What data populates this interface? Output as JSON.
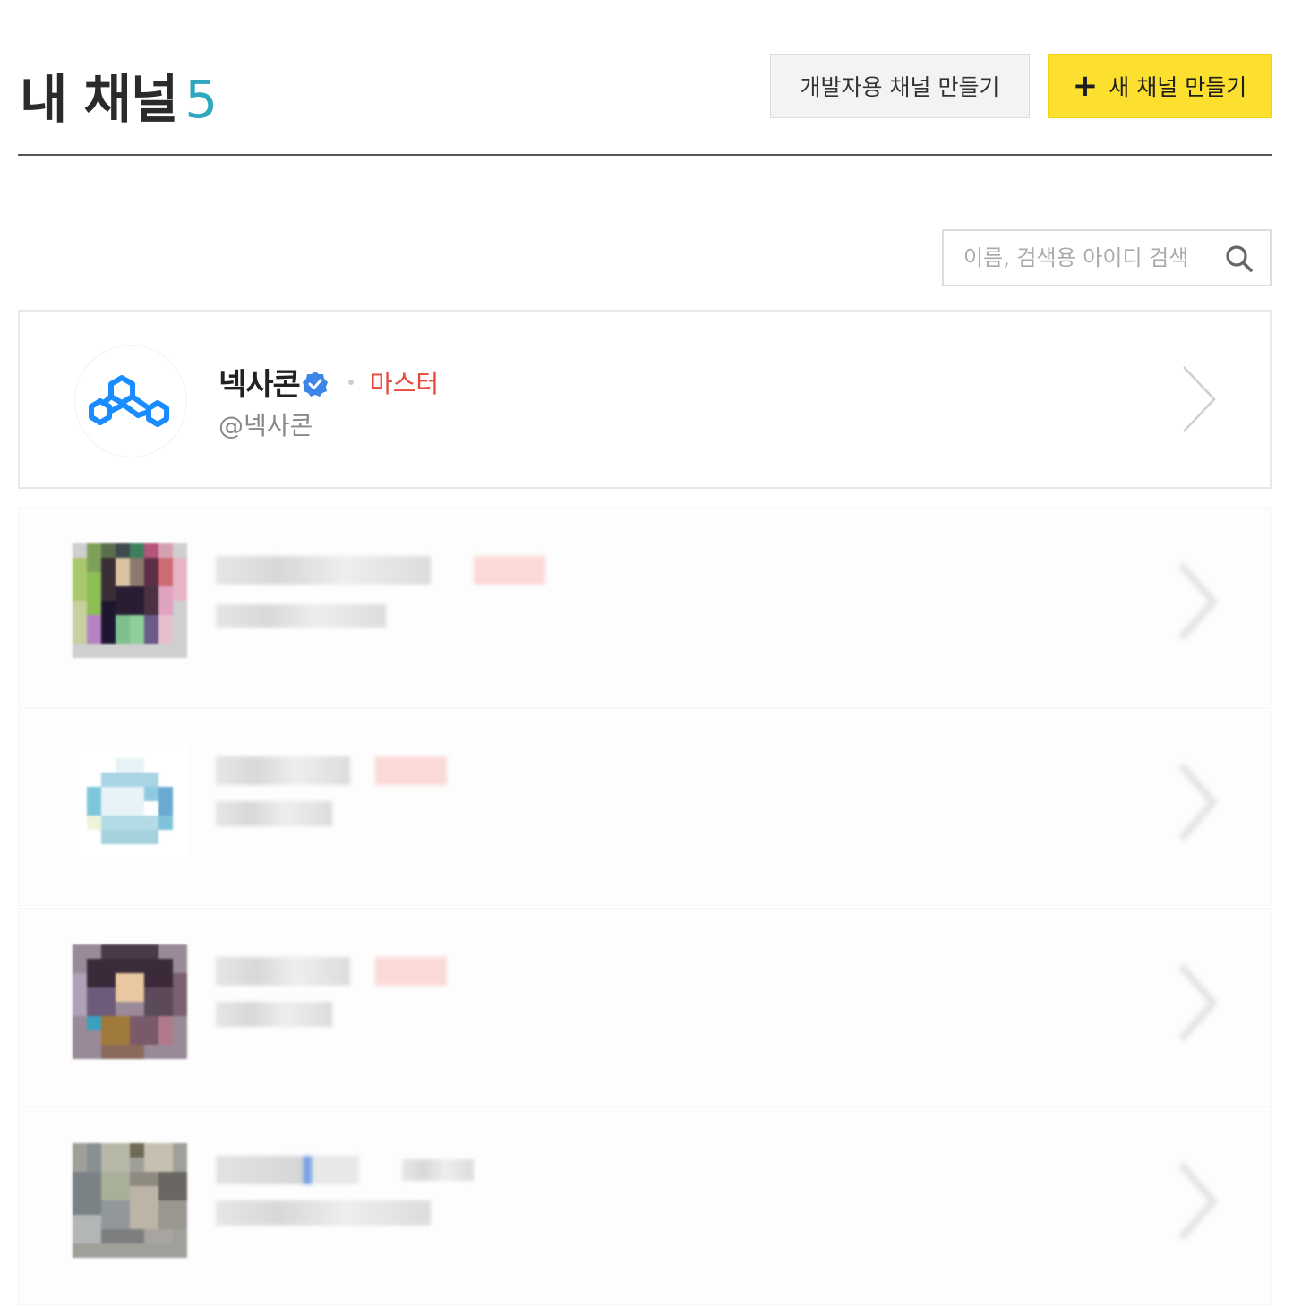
{
  "header": {
    "title": "내 채널",
    "count": "5"
  },
  "buttons": {
    "dev_channel": "개발자용 채널 만들기",
    "new_channel_plus": "+",
    "new_channel": "새 채널 만들기"
  },
  "search": {
    "placeholder": "이름, 검색용 아이디 검색",
    "icon": "search-icon"
  },
  "channels": [
    {
      "name": "넥사콘",
      "verified": true,
      "role": "마스터",
      "handle": "@넥사콘",
      "icon": "nexacon-logo"
    }
  ],
  "colors": {
    "count": "#2fa7be",
    "new_button": "#fde02f",
    "role": "#e8493a",
    "verified": "#3d85e6",
    "logo": "#1a8cff"
  }
}
